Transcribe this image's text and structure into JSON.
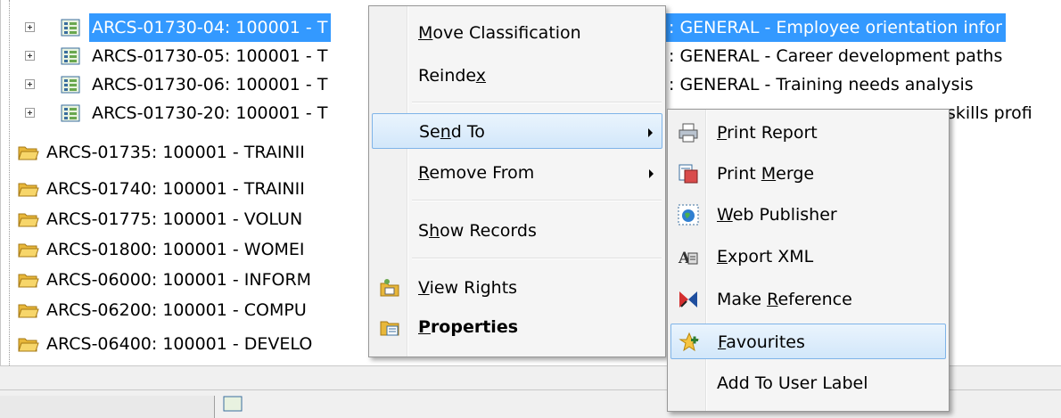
{
  "tree": {
    "rows": [
      {
        "prefix": "ARCS-01730-04: 100001 - T",
        "right_text": ": GENERAL - Employee orientation infor",
        "selected": true,
        "level": 2
      },
      {
        "prefix": "ARCS-01730-05: 100001 - T",
        "right_text": ": GENERAL - Career development paths",
        "selected": false,
        "level": 2
      },
      {
        "prefix": "ARCS-01730-06: 100001 - T",
        "right_text": ": GENERAL - Training needs analysis",
        "selected": false,
        "level": 2
      },
      {
        "prefix": "ARCS-01730-20: 100001 - T",
        "right_text": "skills profi",
        "selected": false,
        "level": 2
      },
      {
        "prefix": "ARCS-01735: 100001 - TRAINII",
        "right_text": "",
        "level": 1
      },
      {
        "prefix": "ARCS-01740: 100001 - TRAINII",
        "right_text": "",
        "level": 1
      },
      {
        "prefix": "ARCS-01775: 100001 - VOLUN",
        "right_text": "",
        "level": 1
      },
      {
        "prefix": "ARCS-01800: 100001 - WOMEI",
        "right_text": "",
        "level": 1
      },
      {
        "prefix": "ARCS-06000: 100001 - INFORM",
        "right_text": "",
        "level": 1
      },
      {
        "prefix": "ARCS-06200: 100001 - COMPU",
        "right_text": "",
        "level": 1
      },
      {
        "prefix": "ARCS-06400: 100001 - DEVELO",
        "right_text": "",
        "level": 1
      }
    ]
  },
  "context_menu": {
    "items": {
      "move_classification": {
        "label": "Move Classification",
        "access_key": "M"
      },
      "reindex": {
        "label_a": "Reinde",
        "label_key": "x",
        "label_b": ""
      },
      "send_to": {
        "label_a": "Se",
        "label_key": "n",
        "label_b": "d To"
      },
      "remove_from": {
        "label_key": "R",
        "label_b": "emove From"
      },
      "show_records": {
        "label_a": "S",
        "label_key": "h",
        "label_b": "ow Records"
      },
      "view_rights": {
        "label_key": "V",
        "label_b": "iew Rights"
      },
      "properties": {
        "label_key": "P",
        "label_b": "roperties"
      }
    }
  },
  "submenu": {
    "items": {
      "print_report": {
        "label_key": "P",
        "label_b": "rint Report"
      },
      "print_merge": {
        "label_a": "Print ",
        "label_key": "M",
        "label_b": "erge"
      },
      "web_publisher": {
        "label_key": "W",
        "label_b": "eb Publisher"
      },
      "export_xml": {
        "label_key": "E",
        "label_b": "xport XML"
      },
      "make_reference": {
        "label_a": "Make ",
        "label_key": "R",
        "label_b": "eference"
      },
      "favourites": {
        "label_key": "F",
        "label_b": "avourites"
      },
      "add_to_user_label": {
        "label_a": "Add To User Label"
      }
    }
  },
  "colors": {
    "selection": "#3399ff",
    "menu_hover_border": "#7fb4e8"
  }
}
